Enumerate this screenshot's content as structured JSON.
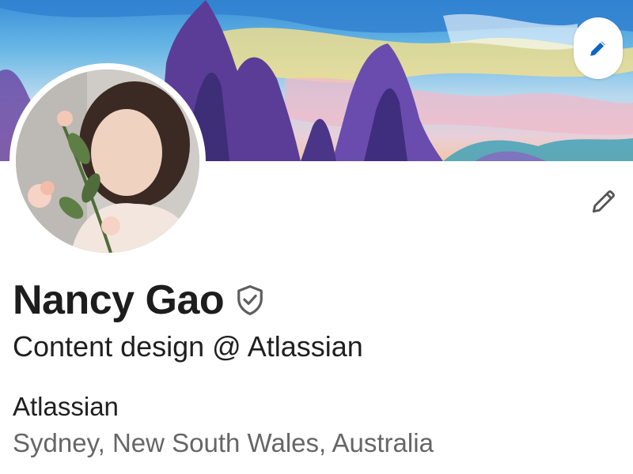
{
  "profile": {
    "name": "Nancy Gao",
    "headline": "Content design @ Atlassian",
    "company": "Atlassian",
    "location": "Sydney, New South Wales, Australia"
  },
  "icons": {
    "banner_edit": "pencil-icon",
    "profile_edit": "pencil-icon",
    "verified": "shield-check-icon"
  },
  "colors": {
    "accent": "#0a66c2",
    "text_primary": "#1d1d1d",
    "text_secondary": "#666666"
  }
}
